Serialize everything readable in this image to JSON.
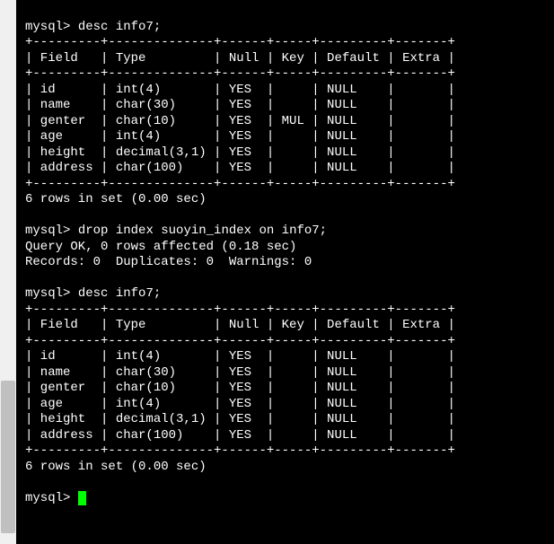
{
  "prompt": "mysql>",
  "cmd1": "desc info7;",
  "cmd2": "drop index suoyin_index on info7;",
  "cmd3": "desc info7;",
  "table_border_top": "+---------+--------------+------+-----+---------+-------+",
  "table_header": "| Field   | Type         | Null | Key | Default | Extra |",
  "table1_rows": [
    "| id      | int(4)       | YES  |     | NULL    |       |",
    "| name    | char(30)     | YES  |     | NULL    |       |",
    "| genter  | char(10)     | YES  | MUL | NULL    |       |",
    "| age     | int(4)       | YES  |     | NULL    |       |",
    "| height  | decimal(3,1) | YES  |     | NULL    |       |",
    "| address | char(100)    | YES  |     | NULL    |       |"
  ],
  "table2_rows": [
    "| id      | int(4)       | YES  |     | NULL    |       |",
    "| name    | char(30)     | YES  |     | NULL    |       |",
    "| genter  | char(10)     | YES  |     | NULL    |       |",
    "| age     | int(4)       | YES  |     | NULL    |       |",
    "| height  | decimal(3,1) | YES  |     | NULL    |       |",
    "| address | char(100)    | YES  |     | NULL    |       |"
  ],
  "rows_summary": "6 rows in set (0.00 sec)",
  "drop_result1": "Query OK, 0 rows affected (0.18 sec)",
  "drop_result2": "Records: 0  Duplicates: 0  Warnings: 0",
  "chart_data": {
    "type": "table",
    "title": "MySQL DESCRIBE output for table info7 (before and after dropping index suoyin_index)",
    "columns": [
      "Field",
      "Type",
      "Null",
      "Key",
      "Default",
      "Extra"
    ],
    "before_drop": [
      {
        "Field": "id",
        "Type": "int(4)",
        "Null": "YES",
        "Key": "",
        "Default": "NULL",
        "Extra": ""
      },
      {
        "Field": "name",
        "Type": "char(30)",
        "Null": "YES",
        "Key": "",
        "Default": "NULL",
        "Extra": ""
      },
      {
        "Field": "genter",
        "Type": "char(10)",
        "Null": "YES",
        "Key": "MUL",
        "Default": "NULL",
        "Extra": ""
      },
      {
        "Field": "age",
        "Type": "int(4)",
        "Null": "YES",
        "Key": "",
        "Default": "NULL",
        "Extra": ""
      },
      {
        "Field": "height",
        "Type": "decimal(3,1)",
        "Null": "YES",
        "Key": "",
        "Default": "NULL",
        "Extra": ""
      },
      {
        "Field": "address",
        "Type": "char(100)",
        "Null": "YES",
        "Key": "",
        "Default": "NULL",
        "Extra": ""
      }
    ],
    "after_drop": [
      {
        "Field": "id",
        "Type": "int(4)",
        "Null": "YES",
        "Key": "",
        "Default": "NULL",
        "Extra": ""
      },
      {
        "Field": "name",
        "Type": "char(30)",
        "Null": "YES",
        "Key": "",
        "Default": "NULL",
        "Extra": ""
      },
      {
        "Field": "genter",
        "Type": "char(10)",
        "Null": "YES",
        "Key": "",
        "Default": "NULL",
        "Extra": ""
      },
      {
        "Field": "age",
        "Type": "int(4)",
        "Null": "YES",
        "Key": "",
        "Default": "NULL",
        "Extra": ""
      },
      {
        "Field": "height",
        "Type": "decimal(3,1)",
        "Null": "YES",
        "Key": "",
        "Default": "NULL",
        "Extra": ""
      },
      {
        "Field": "address",
        "Type": "char(100)",
        "Null": "YES",
        "Key": "",
        "Default": "NULL",
        "Extra": ""
      }
    ]
  }
}
